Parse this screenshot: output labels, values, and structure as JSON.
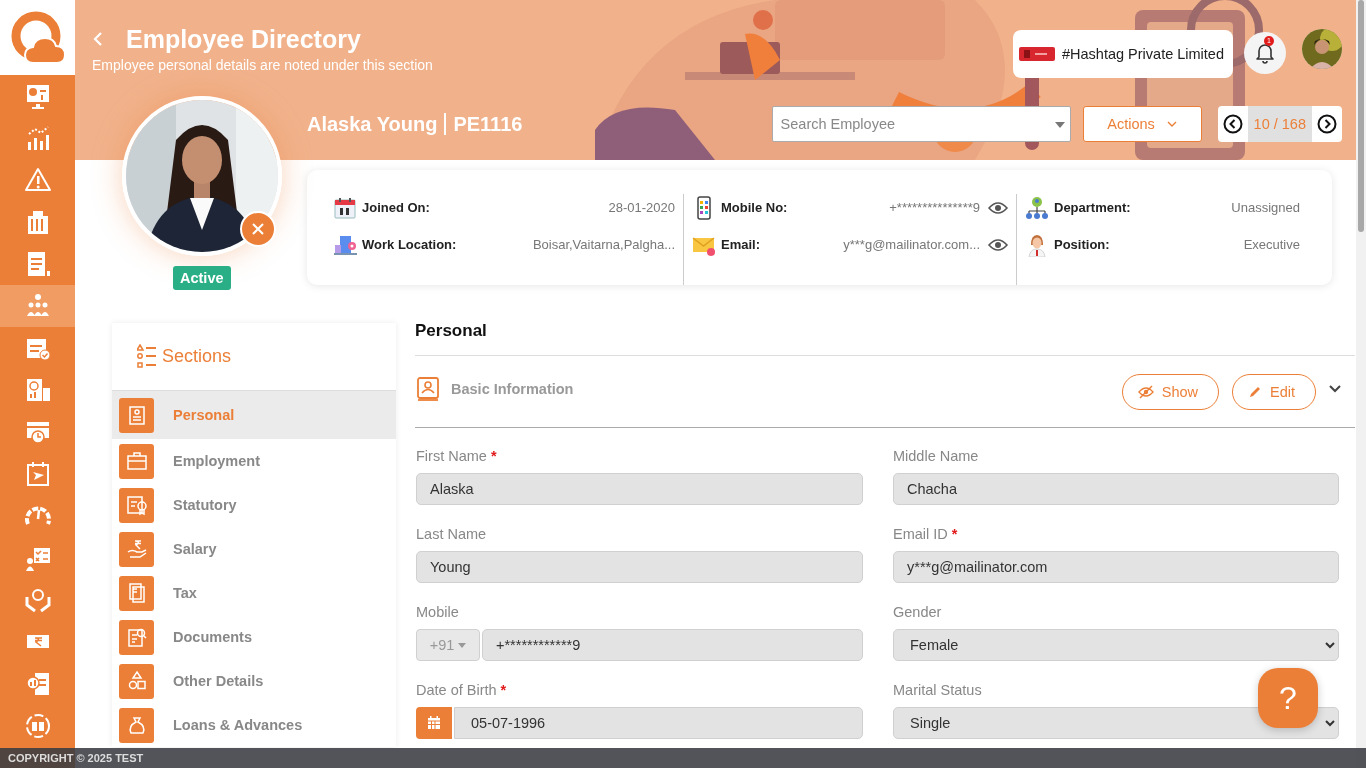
{
  "sidebar": {
    "items": [
      {
        "selected": false
      },
      {
        "selected": false
      },
      {
        "selected": false
      },
      {
        "selected": false
      },
      {
        "selected": false
      },
      {
        "selected": true
      },
      {
        "selected": false
      },
      {
        "selected": false
      },
      {
        "selected": false
      },
      {
        "selected": false
      },
      {
        "selected": false
      },
      {
        "selected": false
      },
      {
        "selected": false
      },
      {
        "selected": false
      },
      {
        "selected": false
      },
      {
        "selected": false
      }
    ]
  },
  "header": {
    "title": "Employee Directory",
    "subtitle": "Employee personal details are noted under this section",
    "company": "#Hashtag Private Limited",
    "notifications": "1",
    "search": {
      "placeholder": "Search Employee"
    },
    "actions": "Actions",
    "pager": "10 / 168"
  },
  "employee": {
    "name": "Alaska Young",
    "code": "PE1116",
    "status": "Active"
  },
  "detail_columns": [
    {
      "items": [
        {
          "label": "Joined On:",
          "value": "28-01-2020",
          "reveal": false
        },
        {
          "label": "Work Location:",
          "value": "Boisar,Vaitarna,Palgha...",
          "reveal": false
        }
      ]
    },
    {
      "items": [
        {
          "label": "Mobile No:",
          "value": "+***************9",
          "reveal": true
        },
        {
          "label": "Email:",
          "value": "y***g@mailinator.com...",
          "reveal": true
        }
      ]
    },
    {
      "items": [
        {
          "label": "Department:",
          "value": "Unassigned",
          "reveal": false
        },
        {
          "label": "Position:",
          "value": "Executive",
          "reveal": false
        }
      ]
    }
  ],
  "sections": {
    "title": "Sections",
    "items": [
      {
        "label": "Personal",
        "selected": true
      },
      {
        "label": "Employment",
        "selected": false
      },
      {
        "label": "Statutory",
        "selected": false
      },
      {
        "label": "Salary",
        "selected": false
      },
      {
        "label": "Tax",
        "selected": false
      },
      {
        "label": "Documents",
        "selected": false
      },
      {
        "label": "Other Details",
        "selected": false
      },
      {
        "label": "Loans & Advances",
        "selected": false
      }
    ]
  },
  "form": {
    "title": "Personal",
    "group": {
      "title": "Basic Information",
      "buttons": [
        {
          "kind": "show",
          "label": "Show"
        },
        {
          "kind": "edit",
          "label": "Edit"
        }
      ]
    },
    "fields": [
      {
        "kind": "text",
        "label": "First Name",
        "required_mark": "*",
        "value": "Alaska"
      },
      {
        "kind": "text",
        "label": "Middle Name",
        "value": "Chacha"
      },
      {
        "kind": "text",
        "label": "Last Name",
        "value": "Young"
      },
      {
        "kind": "text",
        "label": "Email ID",
        "required_mark": "*",
        "value": "y***g@mailinator.com"
      },
      {
        "kind": "phone",
        "label": "Mobile",
        "prefix": "+91",
        "value": "+************9"
      },
      {
        "kind": "select",
        "label": "Gender",
        "value": "Female"
      },
      {
        "kind": "date",
        "label": "Date of Birth",
        "required_mark": "*",
        "value": "05-07-1996"
      },
      {
        "kind": "select",
        "label": "Marital Status",
        "value": "Single"
      }
    ]
  },
  "help": "?",
  "footer": "COPYRIGHT © 2025 TEST"
}
